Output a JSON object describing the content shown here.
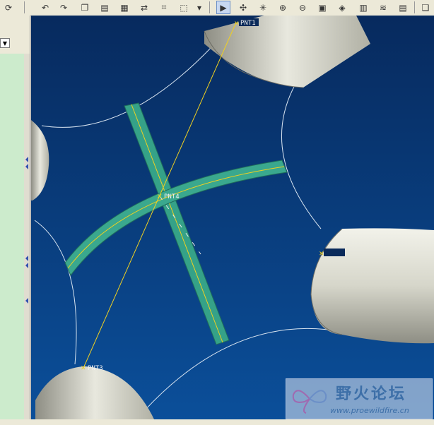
{
  "points": {
    "pnt1": "PNT1",
    "pnt3": "PNT3",
    "pnt4": "PNT4"
  },
  "watermark": {
    "title": "野火论坛",
    "url": "www.proewildfire.cn"
  },
  "left_panel": {
    "combo_arrow": "▼"
  },
  "icons": [
    "regen-icon",
    "undo-icon",
    "redo-icon",
    "copy-icon",
    "paste-icon",
    "paste-special-icon",
    "find-icon",
    "binoculars-icon",
    "select-box-icon",
    "select-dropdown-icon",
    "view-spin-icon",
    "datum-points-icon",
    "spin-center-icon",
    "zoom-in-icon",
    "zoom-out-icon",
    "refit-icon",
    "orient-icon",
    "layers-icon",
    "model-tree-icon"
  ],
  "colors": {
    "viewport_top": "#072a5e",
    "viewport_bottom": "#0b4f9a",
    "rib": "#4cb89a",
    "curve": "#f0d020",
    "cylinder": "#d8d8cc"
  }
}
